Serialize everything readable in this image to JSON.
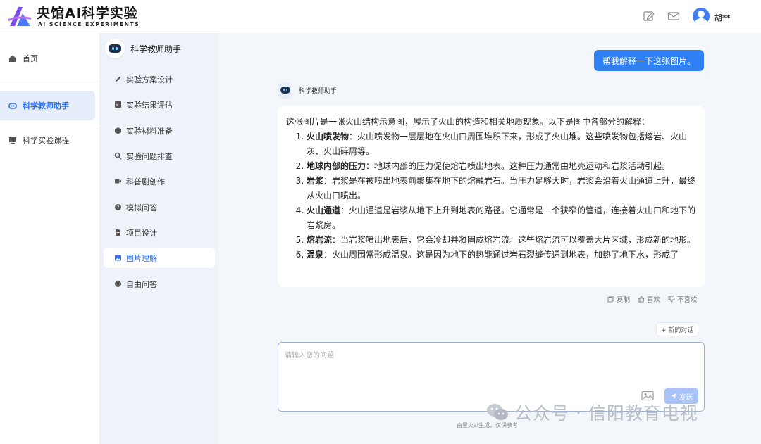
{
  "brand": {
    "title": "央馆AI科学实验",
    "subtitle": "AI SCIENCE EXPERIMENTS",
    "colors": {
      "accent": "#2f6fed",
      "logo_purple": "#7a4de6",
      "logo_blue": "#4a7bf4"
    }
  },
  "header": {
    "user_name": "胡**",
    "icons": [
      "edit-icon",
      "mail-icon",
      "avatar"
    ]
  },
  "left_nav": {
    "items": [
      {
        "label": "首页",
        "icon": "home-icon"
      },
      {
        "label": "科学教师助手",
        "icon": "robot-icon",
        "active": true
      },
      {
        "label": "科学实验课程",
        "icon": "monitor-icon"
      }
    ]
  },
  "submenu": {
    "title": "科学教师助手",
    "items": [
      {
        "label": "实验方案设计",
        "icon": "pencil-icon"
      },
      {
        "label": "实验结果评估",
        "icon": "report-icon"
      },
      {
        "label": "实验材料准备",
        "icon": "box-icon"
      },
      {
        "label": "实验问题排查",
        "icon": "search-icon"
      },
      {
        "label": "科普剧创作",
        "icon": "video-icon"
      },
      {
        "label": "模拟问答",
        "icon": "question-icon"
      },
      {
        "label": "项目设计",
        "icon": "document-icon"
      },
      {
        "label": "图片理解",
        "icon": "image-icon",
        "active": true
      },
      {
        "label": "自由问答",
        "icon": "chat-icon"
      }
    ]
  },
  "chat": {
    "user_message": "帮我解释一下这张图片。",
    "assistant_name": "科学教师助手",
    "answer_intro": "这张图片是一张火山结构示意图，展示了火山的构造和相关地质现象。以下是图中各部分的解释：",
    "answer_items": [
      {
        "term": "火山喷发物",
        "text": "：火山喷发物一层层地在火山口周围堆积下来，形成了火山堆。这些喷发物包括熔岩、火山灰、火山碎屑等。"
      },
      {
        "term": "地球内部的压力",
        "text": "：地球内部的压力促使熔岩喷出地表。这种压力通常由地壳运动和岩浆活动引起。"
      },
      {
        "term": "岩浆",
        "text": "：岩浆是在被喷出地表前聚集在地下的熔融岩石。当压力足够大时，岩浆会沿着火山通道上升，最终从火山口喷出。"
      },
      {
        "term": "火山通道",
        "text": "：火山通道是岩浆从地下上升到地表的路径。它通常是一个狭窄的管道，连接着火山口和地下的岩浆房。"
      },
      {
        "term": "熔岩流",
        "text": "：当岩浆喷出地表后，它会冷却并凝固成熔岩流。这些熔岩流可以覆盖大片区域，形成新的地形。"
      },
      {
        "term": "温泉",
        "text": "：火山周围常形成温泉。这是因为地下的热能通过岩石裂缝传递到地表，加热了地下水，形成了"
      }
    ],
    "actions": {
      "copy": "复制",
      "like": "喜欢",
      "dislike": "不喜欢"
    },
    "new_chat": "+ 新的对话",
    "input_placeholder": "请输入您的问题",
    "send": "发送",
    "footer_note": "由星火ai生成，仅供参考"
  },
  "watermark": {
    "text": "公众号 · 信阳教育电视"
  }
}
